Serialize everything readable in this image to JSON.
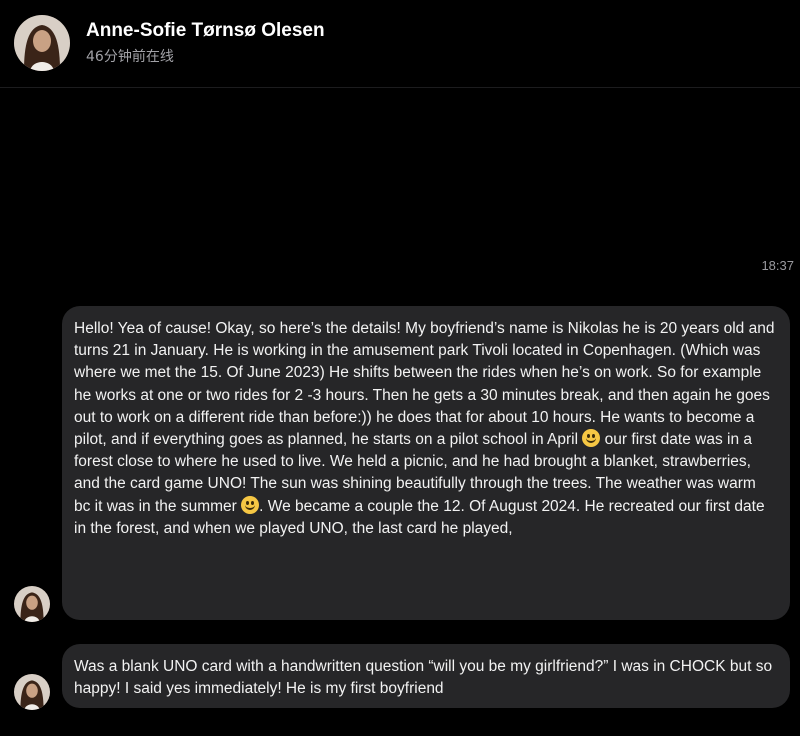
{
  "header": {
    "contact_name": "Anne-Sofie Tørnsø Olesen",
    "status": "46分钟前在线",
    "avatar_icon": "profile-photo"
  },
  "conversation": {
    "timestamp": "18:37",
    "messages": [
      {
        "parts": [
          "Hello! Yea of cause! Okay, so here’s the details! My boyfriend’s name is Nikolas he is 20 years old and turns 21 in January. He is working in the amusement park Tivoli located in Copenhagen. (Which was where we met the 15. Of June 2023) He shifts between the rides when he’s on work. So for example he works at one or two rides for 2 -3 hours. Then he gets a 30 minutes break, and then again he goes out to work on a different ride than before:)) he does that for about 10 hours. He wants to become a pilot, and if everything goes as planned, he starts on a pilot school in April ",
          " our first date was in a forest close to where he used to live. We held a picnic, and he had brought a blanket, strawberries, and the card game UNO! The sun was shining beautifully through the trees. The weather was warm bc it was in the summer ",
          ". We became a couple the 12. Of August 2024. He recreated our first date in the forest, and when we played UNO, the last card he played,"
        ],
        "emoji_icons": [
          "slightly-smiling-face-icon",
          "smiling-face-icon"
        ]
      },
      {
        "parts": [
          "Was a blank UNO card with a handwritten question “will you be my girlfriend?” I was in CHOCK but so happy! I said yes immediately! He is my first boyfriend"
        ]
      }
    ]
  },
  "colors": {
    "background": "#000000",
    "bubble": "#262628",
    "secondary_text": "#a1a1a6"
  }
}
